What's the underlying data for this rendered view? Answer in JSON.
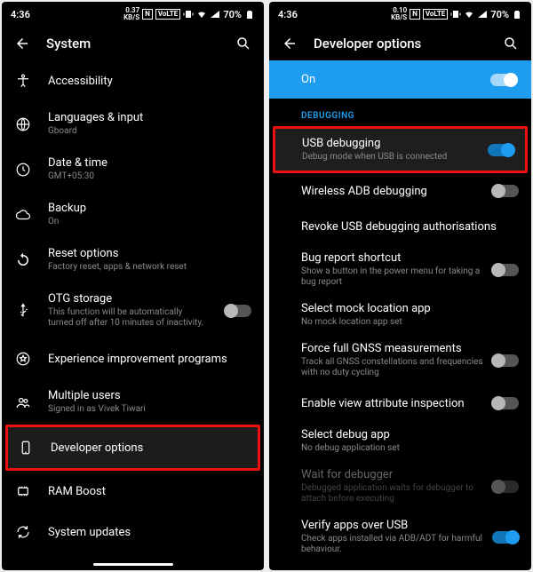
{
  "status": {
    "time": "4:36",
    "speed_value": "0.37",
    "speed_unit": "KB/S",
    "speed_value2": "0.10",
    "n_icon": "N",
    "volte": "VoLTE",
    "battery": "70%"
  },
  "left": {
    "title": "System",
    "items": [
      {
        "name": "accessibility",
        "label": "Accessibility",
        "sub": ""
      },
      {
        "name": "languages",
        "label": "Languages & input",
        "sub": "Gboard"
      },
      {
        "name": "datetime",
        "label": "Date & time",
        "sub": "GMT+05:30"
      },
      {
        "name": "backup",
        "label": "Backup",
        "sub": "On"
      },
      {
        "name": "reset",
        "label": "Reset options",
        "sub": "Factory reset, apps & network reset"
      },
      {
        "name": "otg",
        "label": "OTG storage",
        "sub": "This function will be automatically turned off after 10 minutes of inactivity.",
        "toggle": "off"
      },
      {
        "name": "experience",
        "label": "Experience improvement programs",
        "sub": ""
      },
      {
        "name": "multiusers",
        "label": "Multiple users",
        "sub": "Signed in as Vivek Tiwari"
      },
      {
        "name": "devoptions",
        "label": "Developer options",
        "sub": "",
        "highlight": true
      },
      {
        "name": "ramboost",
        "label": "RAM Boost",
        "sub": ""
      },
      {
        "name": "sysupdates",
        "label": "System updates",
        "sub": ""
      }
    ]
  },
  "right": {
    "title": "Developer options",
    "master": {
      "label": "On",
      "toggle": "on-white"
    },
    "section": "DEBUGGING",
    "items": [
      {
        "name": "usb-debugging",
        "label": "USB debugging",
        "sub": "Debug mode when USB is connected",
        "toggle": "on",
        "highlight": true
      },
      {
        "name": "wireless-adb",
        "label": "Wireless ADB debugging",
        "sub": "",
        "toggle": "off"
      },
      {
        "name": "revoke-auth",
        "label": "Revoke USB debugging authorisations",
        "sub": ""
      },
      {
        "name": "bugreport",
        "label": "Bug report shortcut",
        "sub": "Show a button in the power menu for taking a bug report",
        "toggle": "off"
      },
      {
        "name": "mocklocation",
        "label": "Select mock location app",
        "sub": "No mock location app set"
      },
      {
        "name": "gnss",
        "label": "Force full GNSS measurements",
        "sub": "Track all GNSS constellations and frequencies with no duty cycling",
        "toggle": "off"
      },
      {
        "name": "viewattr",
        "label": "Enable view attribute inspection",
        "sub": "",
        "toggle": "off"
      },
      {
        "name": "debugapp",
        "label": "Select debug app",
        "sub": "No debug application set"
      },
      {
        "name": "waitdebugger",
        "label": "Wait for debugger",
        "sub": "Debugged application waits for debugger to attach before executing",
        "toggle": "off-disabled",
        "disabled": true
      },
      {
        "name": "verifyusb",
        "label": "Verify apps over USB",
        "sub": "Check apps installed via ADB/ADT for harmful behaviour.",
        "toggle": "on"
      }
    ]
  }
}
